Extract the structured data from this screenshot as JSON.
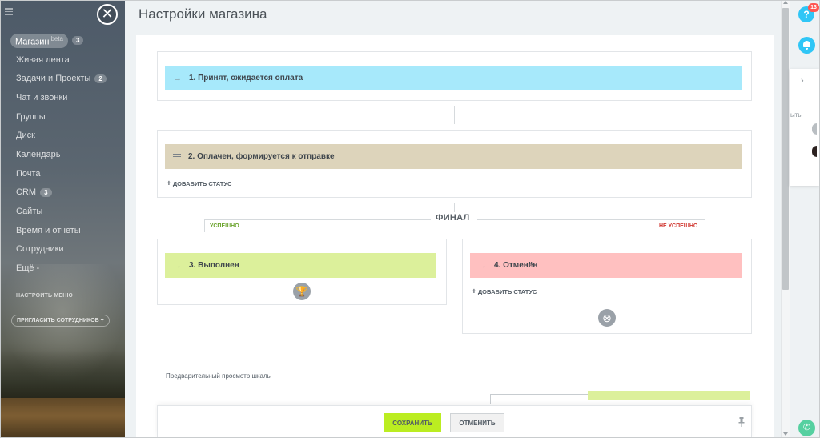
{
  "page": {
    "title": "Настройки магазина"
  },
  "sidebar": {
    "items": [
      {
        "label": "Магазин",
        "beta": "beta",
        "count": "3",
        "active": true
      },
      {
        "label": "Живая лента"
      },
      {
        "label": "Задачи и Проекты",
        "count": "2"
      },
      {
        "label": "Чат и звонки"
      },
      {
        "label": "Группы"
      },
      {
        "label": "Диск"
      },
      {
        "label": "Календарь"
      },
      {
        "label": "Почта"
      },
      {
        "label": "CRM",
        "count": "3"
      },
      {
        "label": "Сайты",
        "beta": ""
      },
      {
        "label": "Время и отчеты"
      },
      {
        "label": "Сотрудники"
      },
      {
        "label": "Ещё -"
      }
    ],
    "setup_menu": "НАСТРОИТЬ МЕНЮ",
    "invite": "ПРИГЛАСИТЬ СОТРУДНИКОВ",
    "invite_plus": "+"
  },
  "statuses": {
    "s1": {
      "label": "1. Принят, ожидается оплата",
      "color": "#a7e9fb"
    },
    "s2": {
      "label": "2. Оплачен, формируется к отправке",
      "color": "#ddd4bb"
    },
    "s3": {
      "label": "3. Выполнен",
      "color": "#dcf09b"
    },
    "s4": {
      "label": "4. Отменён",
      "color": "#ffc0c0"
    }
  },
  "add_status": "ДОБАВИТЬ СТАТУС",
  "final": {
    "label": "ФИНАЛ",
    "success": "УСПЕШНО",
    "failure": "НЕ УСПЕШНО"
  },
  "preview": {
    "label": "Предварительный просмотр шкалы"
  },
  "footer": {
    "save": "СОХРАНИТЬ",
    "cancel": "ОТМЕНИТЬ"
  },
  "right_panel": {
    "help": "?",
    "notifications": "13",
    "popup_text": "ыть"
  },
  "colors": {
    "accent_save": "#bbed21",
    "help_blue": "#2fc6f6",
    "success_green": "#6aa32b",
    "failure_red": "#d0352e"
  }
}
